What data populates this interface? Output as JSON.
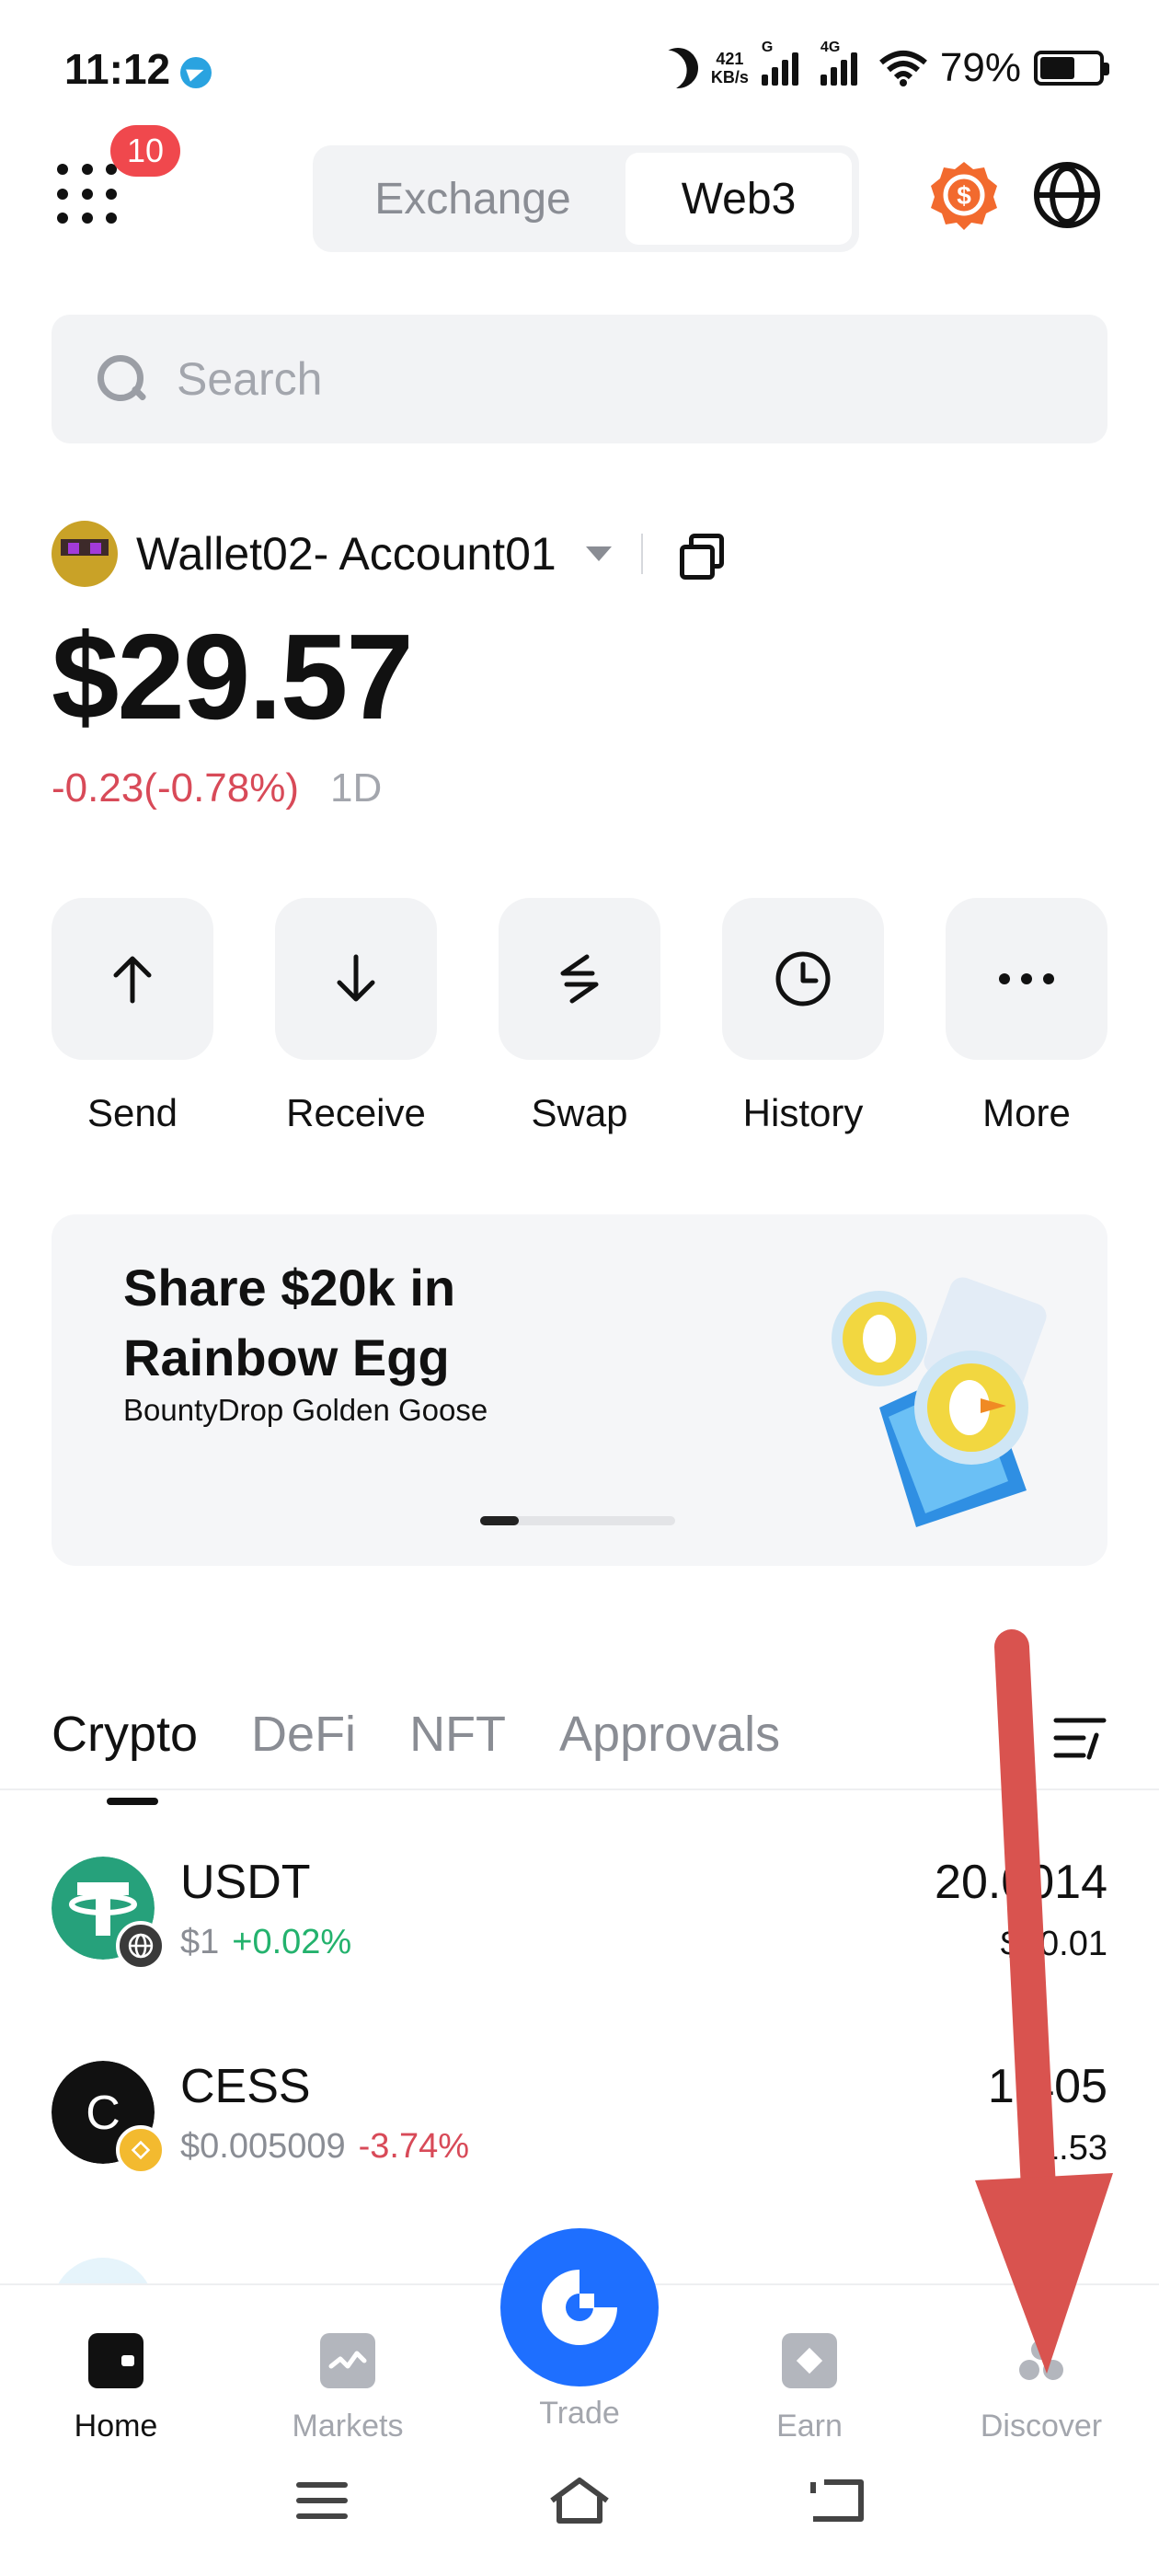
{
  "status_bar": {
    "time": "11:12",
    "net_speed_value": "421",
    "net_speed_unit": "KB/s",
    "signal1_tag": "G",
    "signal2_tag": "4G",
    "battery": "79%"
  },
  "header": {
    "notification_count": "10",
    "tabs": [
      {
        "label": "Exchange",
        "active": false
      },
      {
        "label": "Web3",
        "active": true
      }
    ]
  },
  "search": {
    "placeholder": "Search"
  },
  "wallet": {
    "account_name": "Wallet02- Account01",
    "balance": "$29.57",
    "change": "-0.23(-0.78%)",
    "period": "1D"
  },
  "actions": [
    {
      "label": "Send",
      "icon": "arrow-up-icon"
    },
    {
      "label": "Receive",
      "icon": "arrow-down-icon"
    },
    {
      "label": "Swap",
      "icon": "swap-icon"
    },
    {
      "label": "History",
      "icon": "clock-icon"
    },
    {
      "label": "More",
      "icon": "more-icon"
    }
  ],
  "banner": {
    "title": "Share $20k in Rainbow Egg",
    "subtitle": "BountyDrop Golden Goose",
    "slide_index": 1
  },
  "asset_tabs": [
    {
      "label": "Crypto",
      "active": true
    },
    {
      "label": "DeFi",
      "active": false
    },
    {
      "label": "NFT",
      "active": false
    },
    {
      "label": "Approvals",
      "active": false
    }
  ],
  "assets": [
    {
      "symbol": "USDT",
      "price": "$1",
      "change": "+0.02%",
      "amount": "20.0014",
      "value": "$20.01",
      "color": "#26a17b"
    },
    {
      "symbol": "CESS",
      "price": "$0.005009",
      "change": "-3.74%",
      "amount": "1,405",
      "value": "$1.53",
      "color": "#111111"
    }
  ],
  "bottom_nav": [
    {
      "label": "Home",
      "active": true
    },
    {
      "label": "Markets",
      "active": false
    },
    {
      "label": "Trade",
      "active": false
    },
    {
      "label": "Earn",
      "active": false
    },
    {
      "label": "Discover",
      "active": false
    }
  ],
  "colors": {
    "accent_blue": "#1e6fff",
    "negative": "#d84a58",
    "positive": "#23b26d",
    "annotation_arrow": "#d9534f"
  }
}
